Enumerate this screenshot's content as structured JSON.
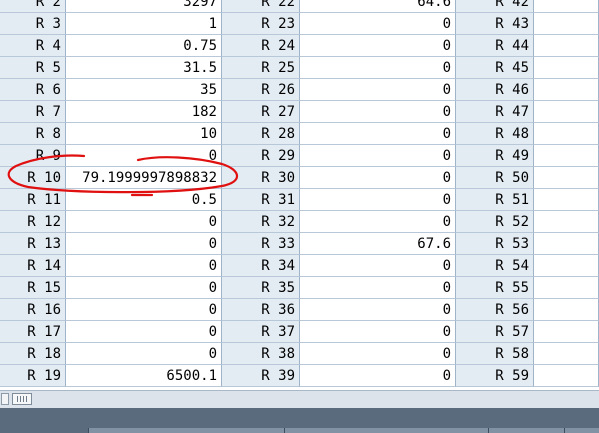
{
  "table": {
    "rows": [
      {
        "l0": "R 2",
        "v0": "3297",
        "l1": "R 22",
        "v1": "64.6",
        "l2": "R 42"
      },
      {
        "l0": "R 3",
        "v0": "1",
        "l1": "R 23",
        "v1": "0",
        "l2": "R 43"
      },
      {
        "l0": "R 4",
        "v0": "0.75",
        "l1": "R 24",
        "v1": "0",
        "l2": "R 44"
      },
      {
        "l0": "R 5",
        "v0": "31.5",
        "l1": "R 25",
        "v1": "0",
        "l2": "R 45"
      },
      {
        "l0": "R 6",
        "v0": "35",
        "l1": "R 26",
        "v1": "0",
        "l2": "R 46"
      },
      {
        "l0": "R 7",
        "v0": "182",
        "l1": "R 27",
        "v1": "0",
        "l2": "R 47"
      },
      {
        "l0": "R 8",
        "v0": "10",
        "l1": "R 28",
        "v1": "0",
        "l2": "R 48"
      },
      {
        "l0": "R 9",
        "v0": "0",
        "l1": "R 29",
        "v1": "0",
        "l2": "R 49"
      },
      {
        "l0": "R 10",
        "v0": "79.1999997898832",
        "l1": "R 30",
        "v1": "0",
        "l2": "R 50"
      },
      {
        "l0": "R 11",
        "v0": "0.5",
        "l1": "R 31",
        "v1": "0",
        "l2": "R 51"
      },
      {
        "l0": "R 12",
        "v0": "0",
        "l1": "R 32",
        "v1": "0",
        "l2": "R 52"
      },
      {
        "l0": "R 13",
        "v0": "0",
        "l1": "R 33",
        "v1": "67.6",
        "l2": "R 53"
      },
      {
        "l0": "R 14",
        "v0": "0",
        "l1": "R 34",
        "v1": "0",
        "l2": "R 54"
      },
      {
        "l0": "R 15",
        "v0": "0",
        "l1": "R 35",
        "v1": "0",
        "l2": "R 55"
      },
      {
        "l0": "R 16",
        "v0": "0",
        "l1": "R 36",
        "v1": "0",
        "l2": "R 56"
      },
      {
        "l0": "R 17",
        "v0": "0",
        "l1": "R 37",
        "v1": "0",
        "l2": "R 57"
      },
      {
        "l0": "R 18",
        "v0": "0",
        "l1": "R 38",
        "v1": "0",
        "l2": "R 58"
      },
      {
        "l0": "R 19",
        "v0": "6500.1",
        "l1": "R 39",
        "v1": "0",
        "l2": "R 59"
      }
    ]
  },
  "annotation": {
    "color": "#e01010",
    "target_row": "R 10"
  },
  "colors": {
    "label_bg": "#e4ecf3",
    "value_bg": "#ffffff",
    "grid_line": "#b8c8d8",
    "statusbar": "#5a6b7d"
  }
}
